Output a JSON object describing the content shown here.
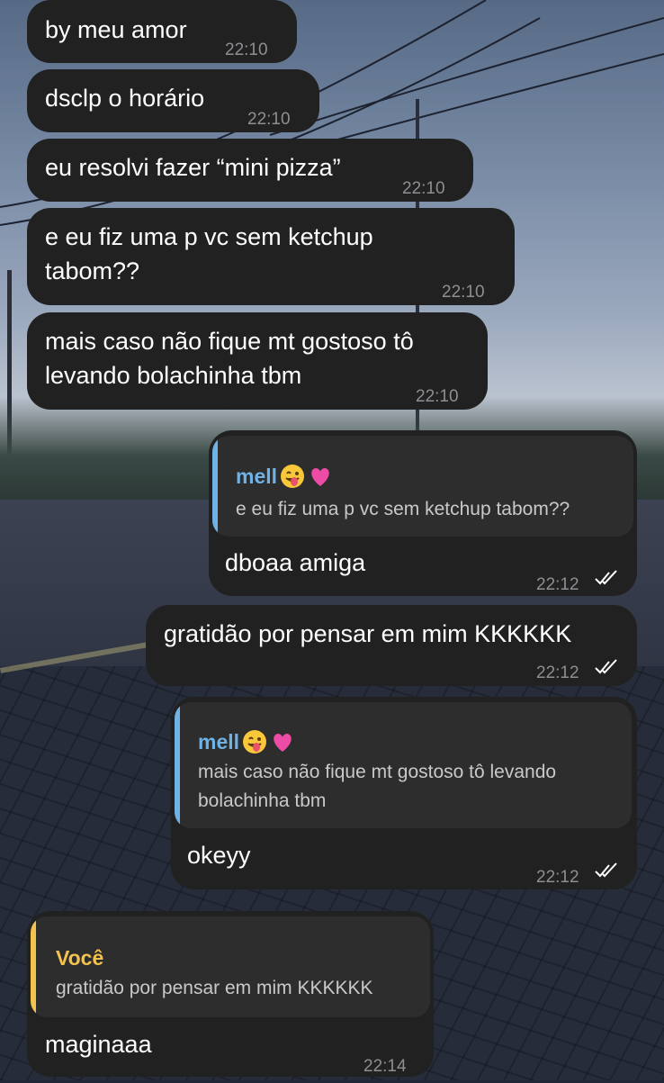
{
  "colors": {
    "bubble_bg": "#212121",
    "quote_bg": "#2d2d2d",
    "reply_name_blue": "#6fb2e6",
    "reply_name_yellow": "#f2c14e",
    "time_gray": "#8e8e93"
  },
  "messages": [
    {
      "side": "left",
      "lines": [
        "by meu amor"
      ],
      "time": "22:10"
    },
    {
      "side": "left",
      "lines": [
        "dsclp o horário"
      ],
      "time": "22:10"
    },
    {
      "side": "left",
      "lines": [
        "eu resolvi fazer “mini pizza”"
      ],
      "time": "22:10"
    },
    {
      "side": "left",
      "lines": [
        "e eu fiz uma p vc sem ketchup",
        "tabom??"
      ],
      "time": "22:10"
    },
    {
      "side": "left",
      "lines": [
        "mais caso não fique mt gostoso tô",
        "levando bolachinha tbm"
      ],
      "time": "22:10"
    },
    {
      "side": "right",
      "reply": {
        "name": "mell",
        "emojis": [
          "tongue-face-emoji",
          "pink-heart-emoji"
        ],
        "lines": [
          "e eu fiz uma p vc sem ketchup tabom??"
        ]
      },
      "lines": [
        "dboaa amiga"
      ],
      "time": "22:12",
      "status": "read"
    },
    {
      "side": "right",
      "lines": [
        "gratidão por pensar em mim KKKKKK"
      ],
      "time": "22:12",
      "status": "read"
    },
    {
      "side": "right",
      "reply": {
        "name": "mell",
        "emojis": [
          "tongue-face-emoji",
          "pink-heart-emoji"
        ],
        "lines": [
          "mais caso não fique mt gostoso tô levando",
          "bolachinha tbm"
        ]
      },
      "lines": [
        "okeyy"
      ],
      "time": "22:12",
      "status": "read"
    },
    {
      "side": "left",
      "reply": {
        "name": "Você",
        "lines": [
          "gratidão por pensar em mim KKKKKK"
        ]
      },
      "lines": [
        "maginaaa"
      ],
      "time": "22:14"
    }
  ]
}
